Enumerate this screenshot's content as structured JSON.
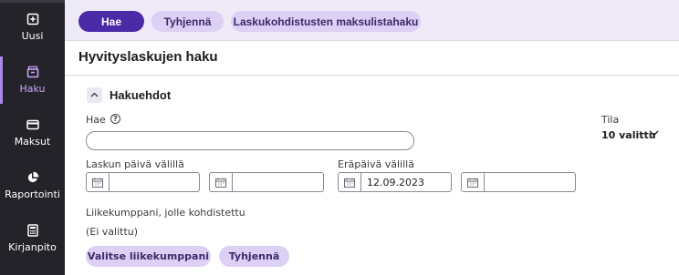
{
  "sidebar": {
    "items": [
      {
        "label": "Uusi",
        "icon": "add-document-icon"
      },
      {
        "label": "Haku",
        "icon": "archive-box-icon",
        "active": true
      },
      {
        "label": "Maksut",
        "icon": "credit-card-icon"
      },
      {
        "label": "Raportointi",
        "icon": "pie-chart-icon"
      },
      {
        "label": "Kirjanpito",
        "icon": "calculator-icon"
      }
    ],
    "active_color": "#c9a8ff"
  },
  "toolbar": {
    "search_label": "Hae",
    "clear_label": "Tyhjennä",
    "payment_list_label": "Laskukohdistusten maksulistahaku"
  },
  "page": {
    "title": "Hyvityslaskujen haku"
  },
  "filters": {
    "section_title": "Hakuehdot",
    "search": {
      "label": "Hae",
      "value": ""
    },
    "status": {
      "label": "Tila",
      "value": "10 valittu"
    },
    "invoice_date": {
      "label": "Laskun päivä välillä",
      "from": "",
      "to": ""
    },
    "due_date": {
      "label": "Eräpäivä välillä",
      "from": "12.09.2023",
      "to": ""
    },
    "partner": {
      "label": "Liikekumppani, jolle kohdistettu",
      "value": "(Ei valittu)",
      "select_label": "Valitse liikekumppani",
      "clear_label": "Tyhjennä"
    }
  },
  "colors": {
    "primary": "#4b2aa8",
    "secondary": "#dcd0f4",
    "sidebar": "#242329"
  }
}
